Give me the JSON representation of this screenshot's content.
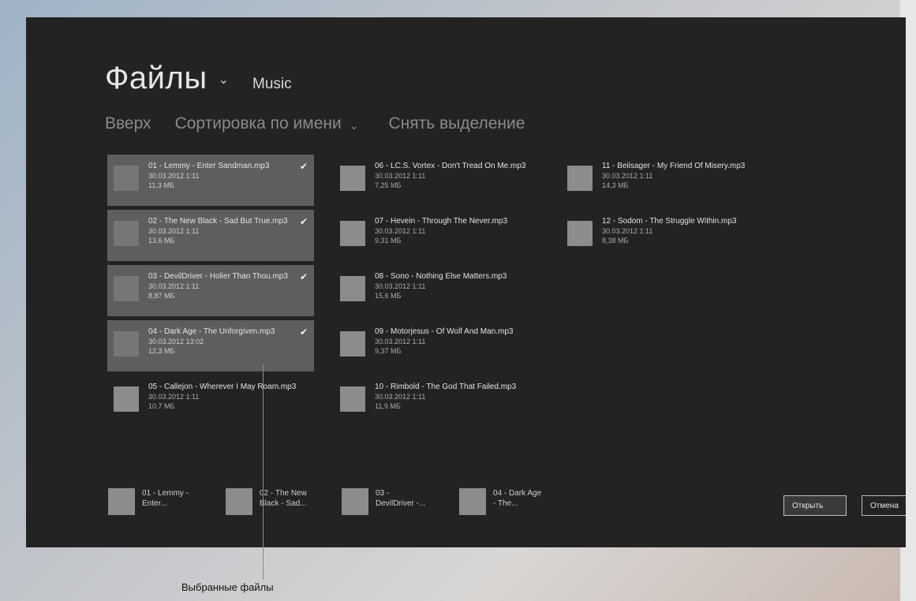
{
  "header": {
    "title": "Файлы",
    "location": "Music"
  },
  "toolbar": {
    "up": "Вверх",
    "sort": "Сортировка по имени",
    "clear": "Снять выделение"
  },
  "files": [
    {
      "name": "01 - Lemmy - Enter Sandman.mp3",
      "date": "30.03.2012 1:11",
      "size": "11,3 МБ",
      "selected": true
    },
    {
      "name": "02 - The New Black - Sad But True.mp3",
      "date": "30.03.2012 1:11",
      "size": "13,6 МБ",
      "selected": true
    },
    {
      "name": "03 - DevilDriver - Holier Than Thou.mp3",
      "date": "30.03.2012 1:11",
      "size": "8,87 МБ",
      "selected": true
    },
    {
      "name": "04 - Dark Age - The Unforgiven.mp3",
      "date": "30.03.2012 13:02",
      "size": "12,3 МБ",
      "selected": true
    },
    {
      "name": "05 - Callejon - Wherever I May Roam.mp3",
      "date": "30.03.2012 1:11",
      "size": "10,7 МБ",
      "selected": false
    },
    {
      "name": "06 - LC.S. Vortex - Don't Tread On Me.mp3",
      "date": "30.03.2012 1:11",
      "size": "7,25 МБ",
      "selected": false
    },
    {
      "name": "07 - Hevein - Through The Never.mp3",
      "date": "30.03.2012 1:11",
      "size": "9,31 МБ",
      "selected": false
    },
    {
      "name": "08 - Sono - Nothing Else Matters.mp3",
      "date": "30.03.2012 1:11",
      "size": "15,6 МБ",
      "selected": false
    },
    {
      "name": "09 - Motorjesus - Of Wolf And Man.mp3",
      "date": "30.03.2012 1:11",
      "size": "9,37 МБ",
      "selected": false
    },
    {
      "name": "10 - Rimbold - The God That Failed.mp3",
      "date": "30.03.2012 1:11",
      "size": "11,9 МБ",
      "selected": false
    },
    {
      "name": "11 - Beilsager - My Friend Of Misery.mp3",
      "date": "30.03.2012 1:11",
      "size": "14,3 МБ",
      "selected": false
    },
    {
      "name": "12 - Sodom - The Struggle Within.mp3",
      "date": "30.03.2012 1:11",
      "size": "8,38 МБ",
      "selected": false
    }
  ],
  "basket": [
    {
      "line1": "01 - Lemmy -",
      "line2": "Enter..."
    },
    {
      "line1": "02 - The New",
      "line2": "Black - Sad..."
    },
    {
      "line1": "03 -",
      "line2": "DevilDriver -..."
    },
    {
      "line1": "04 - Dark Age",
      "line2": "- The..."
    }
  ],
  "buttons": {
    "open": "Открыть",
    "cancel": "Отмена"
  },
  "callout": "Выбранные файлы"
}
